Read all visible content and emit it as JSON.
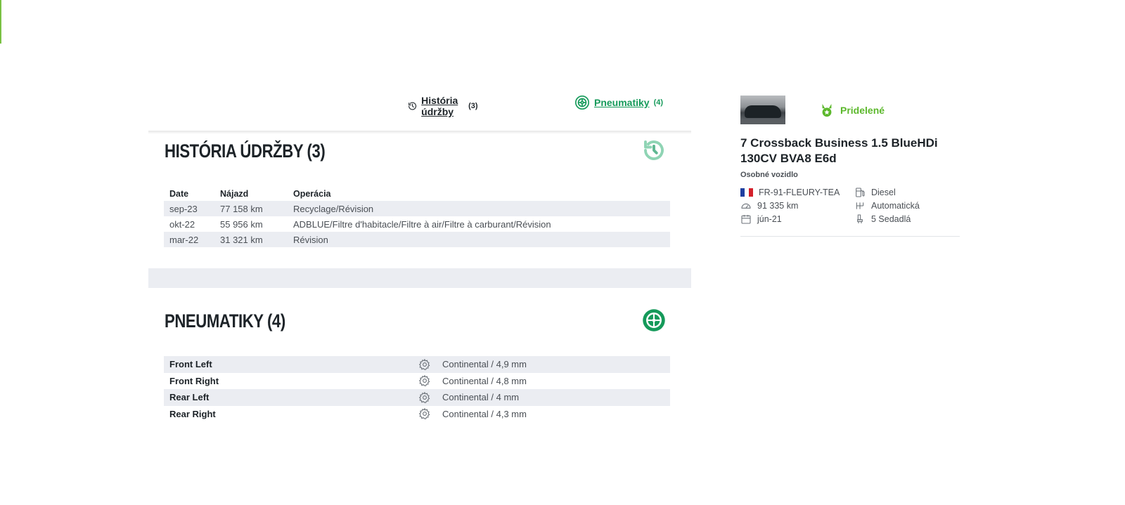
{
  "nav": {
    "maintenance_label": "História údržby",
    "maintenance_count": "(3)",
    "tires_label": "Pneumatiky",
    "tires_count": "(4)"
  },
  "maintenance": {
    "title": "HISTÓRIA ÚDRŽBY (3)",
    "columns": {
      "date": "Date",
      "km": "Nájazd",
      "operation": "Operácia"
    },
    "rows": [
      {
        "date": "sep-23",
        "km": "77 158 km",
        "operation": "Recyclage/Révision"
      },
      {
        "date": "okt-22",
        "km": "55 956 km",
        "operation": "ADBLUE/Filtre d'habitacle/Filtre à air/Filtre à carburant/Révision"
      },
      {
        "date": "mar-22",
        "km": "31 321 km",
        "operation": "Révision"
      }
    ]
  },
  "tires": {
    "title": "PNEUMATIKY (4)",
    "rows": [
      {
        "position": "Front Left",
        "value": "Continental / 4,9 mm"
      },
      {
        "position": "Front Right",
        "value": "Continental / 4,8 mm"
      },
      {
        "position": "Rear Left",
        "value": "Continental / 4 mm"
      },
      {
        "position": "Rear Right",
        "value": "Continental / 4,3 mm"
      }
    ]
  },
  "vehicle": {
    "status": "Pridelené",
    "title": "7 Crossback Business 1.5 BlueHDi 130CV BVA8 E6d",
    "type": "Osobné vozidlo",
    "plate": "FR-91-FLEURY-TEA",
    "fuel": "Diesel",
    "mileage": "91 335 km",
    "transmission": "Automatická",
    "registered": "jún-21",
    "seats": "5 Sedadlá"
  },
  "colors": {
    "brand_green": "#159a5a",
    "status_green": "#5cb82c",
    "light_green": "#8fd4b4",
    "row_shade": "#ebedf2",
    "text_dark": "#1d2328"
  }
}
